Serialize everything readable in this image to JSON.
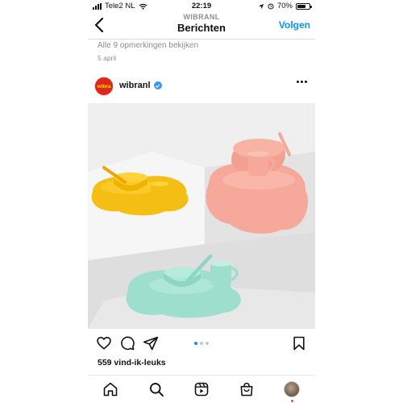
{
  "status_bar": {
    "carrier": "Tele2 NL",
    "time": "22:19",
    "battery": "70%",
    "battery_level": 0.7
  },
  "header": {
    "account": "WIBRANL",
    "title": "Berichten",
    "follow_label": "Volgen",
    "back_icon": "chevron-left-icon"
  },
  "comments": {
    "view_all": "Alle 9 opmerkingen bekijken",
    "date": "5 april"
  },
  "post": {
    "username": "wibranl",
    "avatar_text": "wibra",
    "verified": true,
    "more_icon": "more-horizontal-icon",
    "image_subject": "pastel tableware sets",
    "carousel": {
      "count": 3,
      "active": 1
    },
    "likes": "559 vind-ik-leuks"
  },
  "actions": [
    "heart-icon",
    "comment-icon",
    "share-icon",
    "bookmark-icon"
  ],
  "tabbar": {
    "items": [
      "home-icon",
      "search-icon",
      "reels-icon",
      "shop-icon",
      "profile-avatar"
    ],
    "notification_dot": true
  },
  "colors": {
    "accent": "#0095f6",
    "brand": "#e1251b",
    "yellow_set": "#f5be13",
    "pink_set": "#f6a99a",
    "mint_set": "#9ddfcc"
  }
}
